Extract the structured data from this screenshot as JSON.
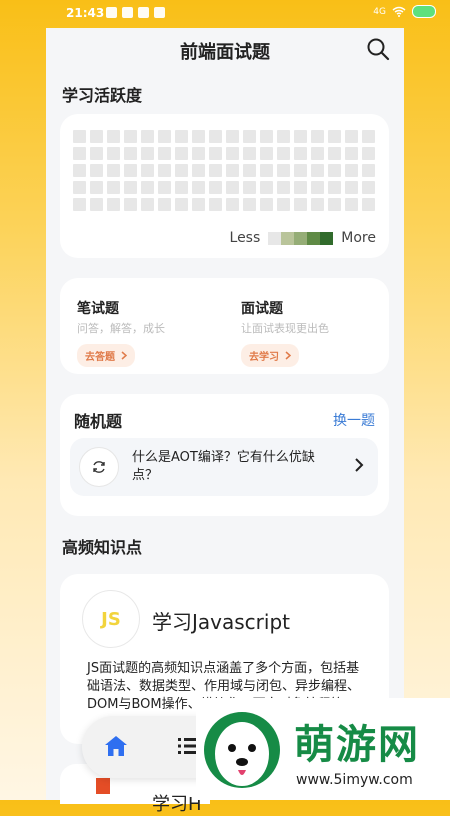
{
  "status": {
    "time": "21:43",
    "network": "4G"
  },
  "header": {
    "title": "前端面试题"
  },
  "activity": {
    "title": "学习活跃度",
    "legend_less": "Less",
    "legend_more": "More",
    "legend_colors": [
      "#e7e7e7",
      "#b9c49a",
      "#95ad76",
      "#5f8a45",
      "#316b2c"
    ]
  },
  "quiz": {
    "left": {
      "title": "笔试题",
      "subtitle": "问答，解答，成长",
      "button": "去答题"
    },
    "right": {
      "title": "面试题",
      "subtitle": "让面试表现更出色",
      "button": "去学习"
    }
  },
  "random": {
    "title": "随机题",
    "change": "换一题",
    "question": "什么是AOT编译？它有什么优缺点？"
  },
  "knowledge": {
    "title": "高频知识点",
    "js": {
      "badge": "JS",
      "title": "学习Javascript",
      "desc": "JS面试题的高频知识点涵盖了多个方面，包括基础语法、数据类型、作用域与闭包、异步编程、DOM与BOM操作、模块化、面向对象编程等"
    },
    "next_partial": "学习H"
  },
  "watermark": {
    "text": "萌游网",
    "url": "www.5imyw.com"
  },
  "colors": {
    "accent": "#3a7bd5",
    "pill_text": "#e07b4a",
    "js_yellow": "#f2d43c"
  }
}
